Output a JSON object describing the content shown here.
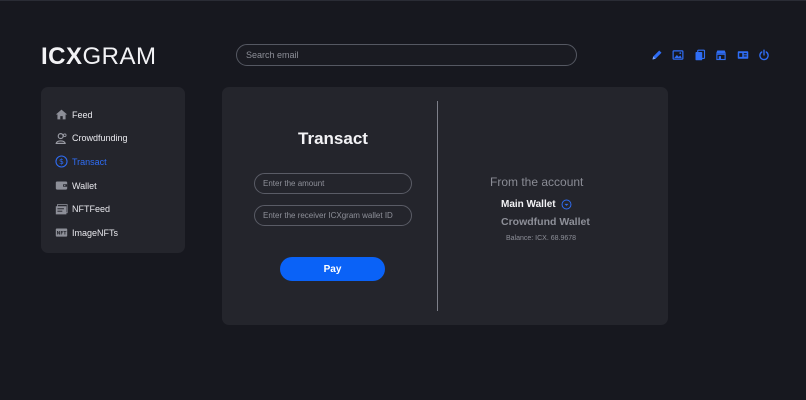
{
  "colors": {
    "accent": "#0a62f7",
    "background": "#17181f",
    "panel": "#24252c"
  },
  "header": {
    "logo_bold": "ICX",
    "logo_light": "GRAM",
    "search_placeholder": "Search email",
    "icons": [
      "pencil-icon",
      "image-icon",
      "copy-icon",
      "store-icon",
      "wallet-card-icon",
      "power-icon"
    ]
  },
  "sidebar": {
    "items": [
      {
        "label": "Feed",
        "icon": "home-icon",
        "active": false
      },
      {
        "label": "Crowdfunding",
        "icon": "people-icon",
        "active": false
      },
      {
        "label": "Transact",
        "icon": "dollar-icon",
        "active": true
      },
      {
        "label": "Wallet",
        "icon": "wallet-icon",
        "active": false
      },
      {
        "label": "NFTFeed",
        "icon": "nft-feed-icon",
        "active": false
      },
      {
        "label": "ImageNFTs",
        "icon": "image-nft-icon",
        "active": false
      }
    ]
  },
  "transact": {
    "title": "Transact",
    "amount_placeholder": "Enter the amount",
    "receiver_placeholder": "Enter the receiver ICXgram wallet ID",
    "pay_label": "Pay"
  },
  "account": {
    "from_label": "From the account",
    "main_wallet": "Main Wallet",
    "crowdfund_wallet": "Crowdfund Wallet",
    "balance": "Balance: ICX. 68.9678"
  }
}
